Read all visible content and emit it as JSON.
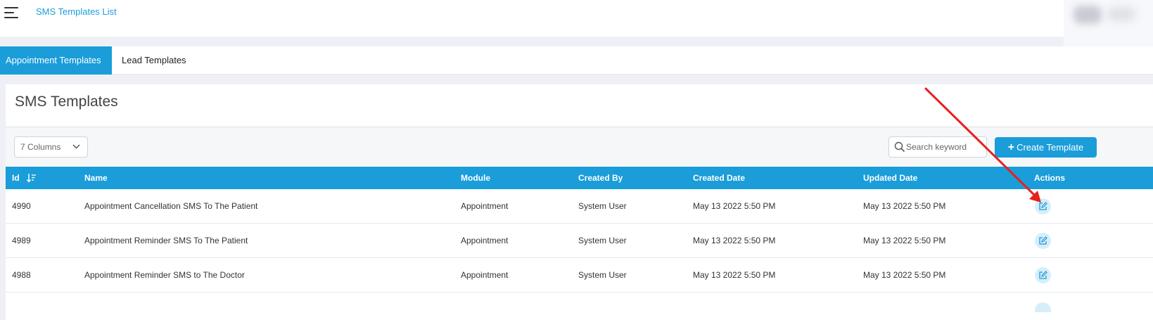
{
  "header": {
    "page_title": "SMS Templates List"
  },
  "tabs": [
    {
      "label": "Appointment Templates",
      "active": true
    },
    {
      "label": "Lead Templates",
      "active": false
    }
  ],
  "card": {
    "title": "SMS Templates"
  },
  "toolbar": {
    "columns_select": "7 Columns",
    "search_placeholder": "Search keyword",
    "create_label": "Create Template"
  },
  "table": {
    "columns": [
      "Id",
      "Name",
      "Module",
      "Created By",
      "Created Date",
      "Updated Date",
      "Actions"
    ],
    "rows": [
      {
        "id": "4990",
        "name": "Appointment Cancellation SMS To The Patient",
        "module": "Appointment",
        "created_by": "System User",
        "created_date": "May 13 2022 5:50 PM",
        "updated_date": "May 13 2022 5:50 PM"
      },
      {
        "id": "4989",
        "name": "Appointment Reminder SMS To The Patient",
        "module": "Appointment",
        "created_by": "System User",
        "created_date": "May 13 2022 5:50 PM",
        "updated_date": "May 13 2022 5:50 PM"
      },
      {
        "id": "4988",
        "name": "Appointment Reminder SMS to The Doctor",
        "module": "Appointment",
        "created_by": "System User",
        "created_date": "May 13 2022 5:50 PM",
        "updated_date": "May 13 2022 5:50 PM"
      }
    ]
  },
  "icons": {
    "menu": "hamburger-menu-icon",
    "search": "search-icon",
    "sort": "sort-descending-icon",
    "edit": "edit-icon",
    "annotation": "red-arrow-annotation"
  },
  "colors": {
    "accent": "#1a9dd9",
    "annotation_arrow": "#e8201e"
  }
}
